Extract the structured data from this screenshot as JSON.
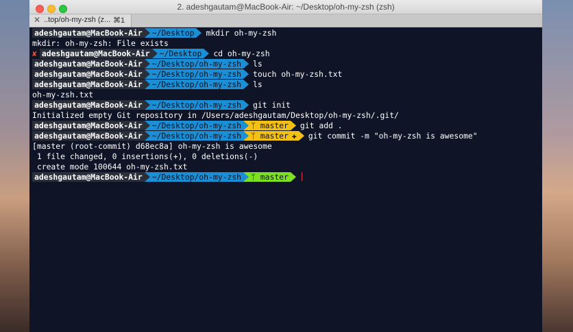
{
  "window": {
    "title": "2. adeshgautam@MacBook-Air: ~/Desktop/oh-my-zsh (zsh)"
  },
  "tab": {
    "close": "✕",
    "title": "..top/oh-my-zsh (z...",
    "shortcut": "⌘1"
  },
  "colors": {
    "user_segment": "#2b2f3a",
    "dir_segment": "#1b8fd6",
    "git_dirty_segment": "#f3c116",
    "git_clean_segment": "#7ee023",
    "error": "#ff4f3a",
    "terminal_bg": "#0f1426"
  },
  "terminal": {
    "lines": [
      {
        "type": "prompt",
        "user": "adeshgautam@MacBook-Air",
        "dir": "~/Desktop",
        "command": "mkdir oh-my-zsh"
      },
      {
        "type": "output",
        "text": "mkdir: oh-my-zsh: File exists"
      },
      {
        "type": "prompt",
        "error": "✘",
        "user": "adeshgautam@MacBook-Air",
        "dir": "~/Desktop",
        "command": "cd oh-my-zsh"
      },
      {
        "type": "prompt",
        "user": "adeshgautam@MacBook-Air",
        "dir": "~/Desktop/oh-my-zsh",
        "command": "ls"
      },
      {
        "type": "prompt",
        "user": "adeshgautam@MacBook-Air",
        "dir": "~/Desktop/oh-my-zsh",
        "command": "touch oh-my-zsh.txt"
      },
      {
        "type": "prompt",
        "user": "adeshgautam@MacBook-Air",
        "dir": "~/Desktop/oh-my-zsh",
        "command": "ls"
      },
      {
        "type": "output",
        "text": "oh-my-zsh.txt"
      },
      {
        "type": "prompt",
        "user": "adeshgautam@MacBook-Air",
        "dir": "~/Desktop/oh-my-zsh",
        "command": "git init"
      },
      {
        "type": "output",
        "text": "Initialized empty Git repository in /Users/adeshgautam/Desktop/oh-my-zsh/.git/"
      },
      {
        "type": "prompt",
        "user": "adeshgautam@MacBook-Air",
        "dir": "~/Desktop/oh-my-zsh",
        "branch": "master",
        "git_state": "dirty",
        "command": "git add ."
      },
      {
        "type": "prompt",
        "user": "adeshgautam@MacBook-Air",
        "dir": "~/Desktop/oh-my-zsh",
        "branch": "master",
        "git_state": "staged",
        "command": "git commit -m \"oh-my-zsh is awesome\""
      },
      {
        "type": "output",
        "text": "[master (root-commit) d68ec8a] oh-my-zsh is awesome"
      },
      {
        "type": "output",
        "text": " 1 file changed, 0 insertions(+), 0 deletions(-)"
      },
      {
        "type": "output",
        "text": " create mode 100644 oh-my-zsh.txt"
      },
      {
        "type": "prompt",
        "user": "adeshgautam@MacBook-Air",
        "dir": "~/Desktop/oh-my-zsh",
        "branch": "master",
        "git_state": "clean",
        "command": "",
        "cursor": true
      }
    ]
  }
}
